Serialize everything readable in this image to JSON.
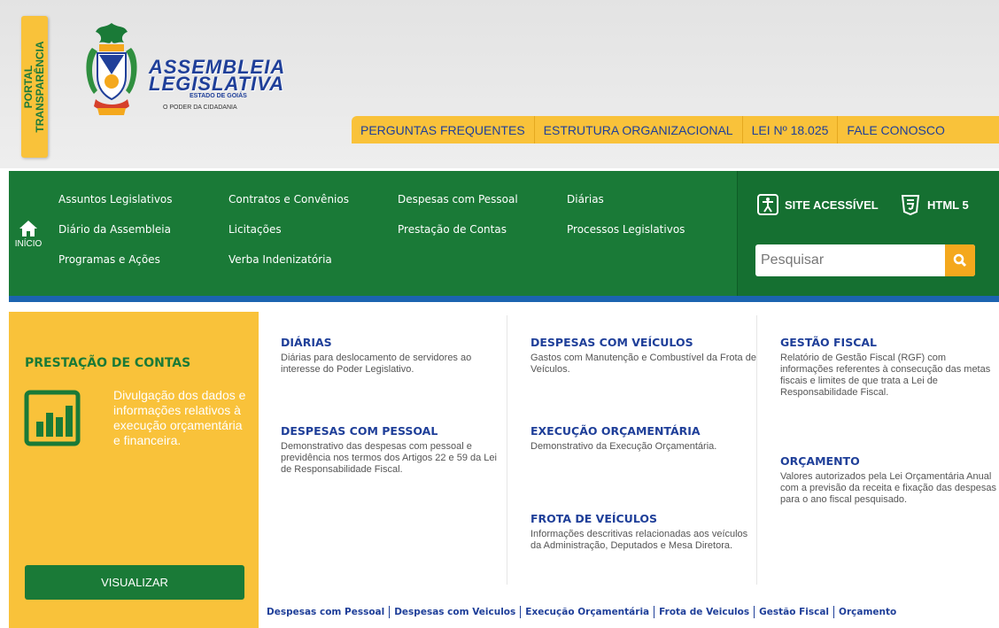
{
  "portal": {
    "line1": "PORTAL",
    "line2": "TRANSPARÊNCIA"
  },
  "logo": {
    "line1": "ASSEMBLEIA",
    "line2": "LEGISLATIVA",
    "line3": "ESTADO DE GOIÁS",
    "tagline": "O PODER DA CIDADANIA"
  },
  "top_nav": [
    "PERGUNTAS FREQUENTES",
    "ESTRUTURA ORGANIZACIONAL",
    "LEI Nº 18.025",
    "FALE CONOSCO"
  ],
  "main_nav": {
    "home_label": "INÍCIO",
    "col1": [
      "Assuntos Legislativos",
      "Diário da Assembleia",
      "Programas e Ações"
    ],
    "col2": [
      "Contratos e Convênios",
      "Licitações",
      "Verba Indenizatória"
    ],
    "col3": [
      "Despesas com Pessoal",
      "Prestação de Contas"
    ],
    "col4": [
      "Diárias",
      "Processos Legislativos"
    ]
  },
  "accessibility": {
    "site_label": "SITE ACESSÍVEL",
    "html_label": "HTML 5"
  },
  "search": {
    "placeholder": "Pesquisar"
  },
  "panel": {
    "title": "PRESTAÇÃO DE CONTAS",
    "description": "Divulgação dos dados e informações relativos à execução orçamentária e financeira.",
    "button": "VISUALIZAR"
  },
  "sections": {
    "diarias": {
      "title": "DIÁRIAS",
      "text": "Diárias para deslocamento de servidores ao interesse do Poder Legislativo."
    },
    "despesas_pessoal": {
      "title": "DESPESAS COM PESSOAL",
      "text": "Demonstrativo das despesas com pessoal e previdência nos termos dos Artigos 22 e 59 da Lei de Responsabilidade Fiscal."
    },
    "despesas_veiculos": {
      "title": "DESPESAS COM VEÍCULOS",
      "text": "Gastos com Manutenção e Combustível da Frota de Veículos."
    },
    "execucao": {
      "title": "EXECUÇÃO ORÇAMENTÁRIA",
      "text": "Demonstrativo da Execução Orçamentária."
    },
    "frota": {
      "title": "FROTA DE VEÍCULOS",
      "text": "Informações descritivas relacionadas aos veículos da Administração, Deputados e Mesa Diretora."
    },
    "gestao": {
      "title": "GESTÃO FISCAL",
      "text": "Relatório de Gestão Fiscal (RGF) com informações referentes à consecução das metas fiscais e limites de que trata a Lei de Responsabilidade Fiscal."
    },
    "orcamento": {
      "title": "ORÇAMENTO",
      "text": "Valores autorizados pela Lei Orçamentária Anual com a previsão da receita e fixação das despesas para o ano fiscal pesquisado."
    }
  },
  "bottom_links": [
    "Despesas com Pessoal",
    "Despesas com Veiculos",
    "Execução Orçamentária",
    "Frota de Veiculos",
    "Gestão Fiscal",
    "Orçamento"
  ],
  "colors": {
    "green": "#1a7a37",
    "yellow": "#f9c23a",
    "blue": "#1f3f99",
    "orange": "#f4a81d"
  }
}
